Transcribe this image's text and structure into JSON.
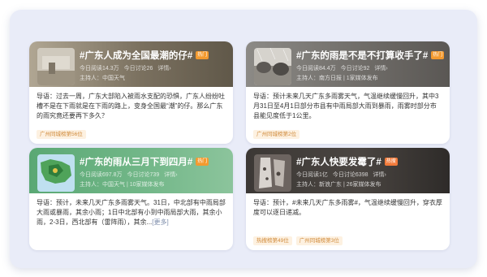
{
  "cards": [
    {
      "title": "#广东人成为全国最潮的仔#",
      "tag": "热门",
      "reads": "今日阅读14.3万",
      "discussions": "今日讨论26",
      "details": "详情",
      "host": "主持人：中国天气",
      "body": "导语：过去一周，广东大部陷入被雨水支配的恐惧，广东人纷纷吐槽不是在下雨就是在下雨的路上，变身全国最“潮”的仔。那么广东的雨究竟还要再下多久？",
      "more": "",
      "badges": [
        "广州同城榜第56位"
      ],
      "header_gradient": [
        "#b4aa98",
        "#6b6356"
      ]
    },
    {
      "title": "#广东的雨是不是不打算收手了#",
      "tag": "热门",
      "reads": "今日阅读84.4万",
      "discussions": "今日讨论92",
      "details": "详情",
      "host": "主持人：南方日报 | 1家媒体发布",
      "body": "导语：预计未来几天广东多雨雾天气，气温继续缓慢回升，其中3月31日至4月1日部分市县有中雨局部大雨到暴雨，雨雾时部分市县能见度低于1公里。",
      "more": "",
      "badges": [
        "广州同城榜第2位"
      ],
      "header_gradient": [
        "#c8c4bc",
        "#7d7a75"
      ]
    },
    {
      "title": "#广东的雨从三月下到四月#",
      "tag": "热门",
      "reads": "今日阅读697.8万",
      "discussions": "今日讨论739",
      "details": "详情",
      "host": "主持人：中国天气 | 10家媒体发布",
      "body": "导语：预计，未来几天广东多雨雾天气。31日，中北部有中雨局部大雨或暴雨，其余小雨；1日中北部有小到中雨局部大雨，其余小雨，2-3日，西北部有（雷阵雨），其余...",
      "more": "[更多]",
      "badges": [],
      "header_gradient": [
        "#7fbf92",
        "#3d8f5e"
      ]
    },
    {
      "title": "#广东人快要发霉了#",
      "tag": "热搜",
      "reads": "今日阅读1亿",
      "discussions": "今日讨论6398",
      "details": "详情",
      "host": "主持人：新浪广东 | 26家媒体发布",
      "body": "导语：预计，#未来几天广东多雨雾#，气温继续缓慢回升，穿衣厚度可以逐日递减。",
      "more": "",
      "badges": [
        "热搜榜第49位",
        "广州同城榜第3位"
      ],
      "header_gradient": [
        "#6e6660",
        "#2a2725"
      ]
    }
  ]
}
